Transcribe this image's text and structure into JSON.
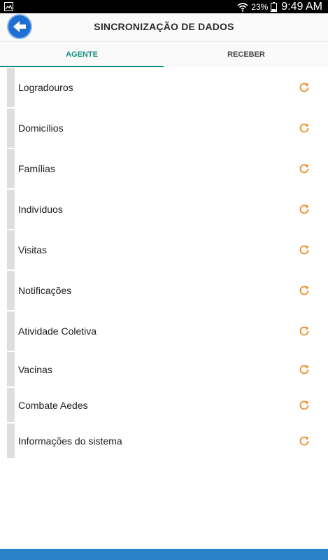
{
  "status_bar": {
    "battery_percent": "23%",
    "time": "9:49 AM",
    "icons": [
      "image-notification-icon",
      "wifi-icon",
      "battery-icon"
    ]
  },
  "app_bar": {
    "title": "SINCRONIZAÇÃO DE DADOS",
    "back_icon": "back-arrow-icon"
  },
  "tabs": [
    {
      "label": "AGENTE",
      "active": true
    },
    {
      "label": "RECEBER",
      "active": false
    }
  ],
  "sync_items": [
    {
      "label": "Logradouros",
      "icon": "sync-icon"
    },
    {
      "label": "Domicílios",
      "icon": "sync-icon"
    },
    {
      "label": "Famílias",
      "icon": "sync-icon"
    },
    {
      "label": "Indivíduos",
      "icon": "sync-icon"
    },
    {
      "label": "Visitas",
      "icon": "sync-icon"
    },
    {
      "label": "Notificações",
      "icon": "sync-icon"
    },
    {
      "label": "Atividade Coletiva",
      "icon": "sync-icon"
    },
    {
      "label": "Vacinas",
      "icon": "sync-icon"
    },
    {
      "label": "Combate Aedes",
      "icon": "sync-icon"
    },
    {
      "label": "Informações do sistema",
      "icon": "sync-icon"
    }
  ],
  "colors": {
    "accent": "#0f8f80",
    "sync_icon": "#f08a24",
    "back_button": "#1e6fd1",
    "bottom_bar": "#2a82c9"
  }
}
